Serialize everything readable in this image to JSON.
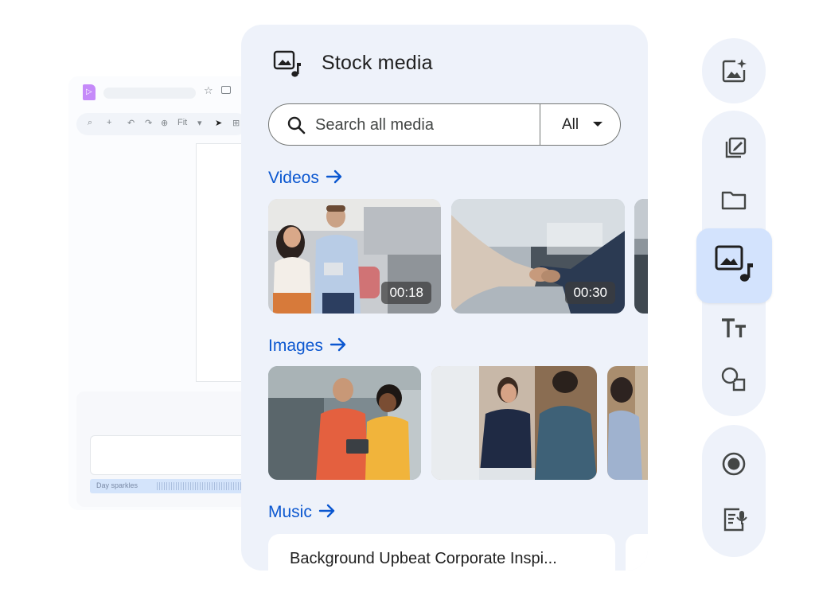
{
  "background_editor": {
    "toolbar": {
      "zoom_label": "Fit"
    },
    "audio_clip_label": "Day sparkles"
  },
  "panel": {
    "title": "Stock media",
    "search": {
      "placeholder": "Search all media",
      "filter_label": "All"
    },
    "sections": {
      "videos": {
        "label": "Videos",
        "items": [
          {
            "duration": "00:18"
          },
          {
            "duration": "00:30"
          }
        ]
      },
      "images": {
        "label": "Images"
      },
      "music": {
        "label": "Music",
        "items": [
          {
            "title": "Background Upbeat Corporate Inspi..."
          }
        ]
      }
    }
  },
  "rail": {
    "icons": [
      "image-sparkle-icon",
      "edit-frame-icon",
      "folder-icon",
      "stock-media-icon",
      "text-icon",
      "shapes-icon",
      "record-icon",
      "voiceover-icon"
    ],
    "active": "stock-media-icon"
  },
  "colors": {
    "accent": "#0b57d0",
    "panel_bg": "#eef2fa",
    "active_bg": "#d3e3fd"
  }
}
